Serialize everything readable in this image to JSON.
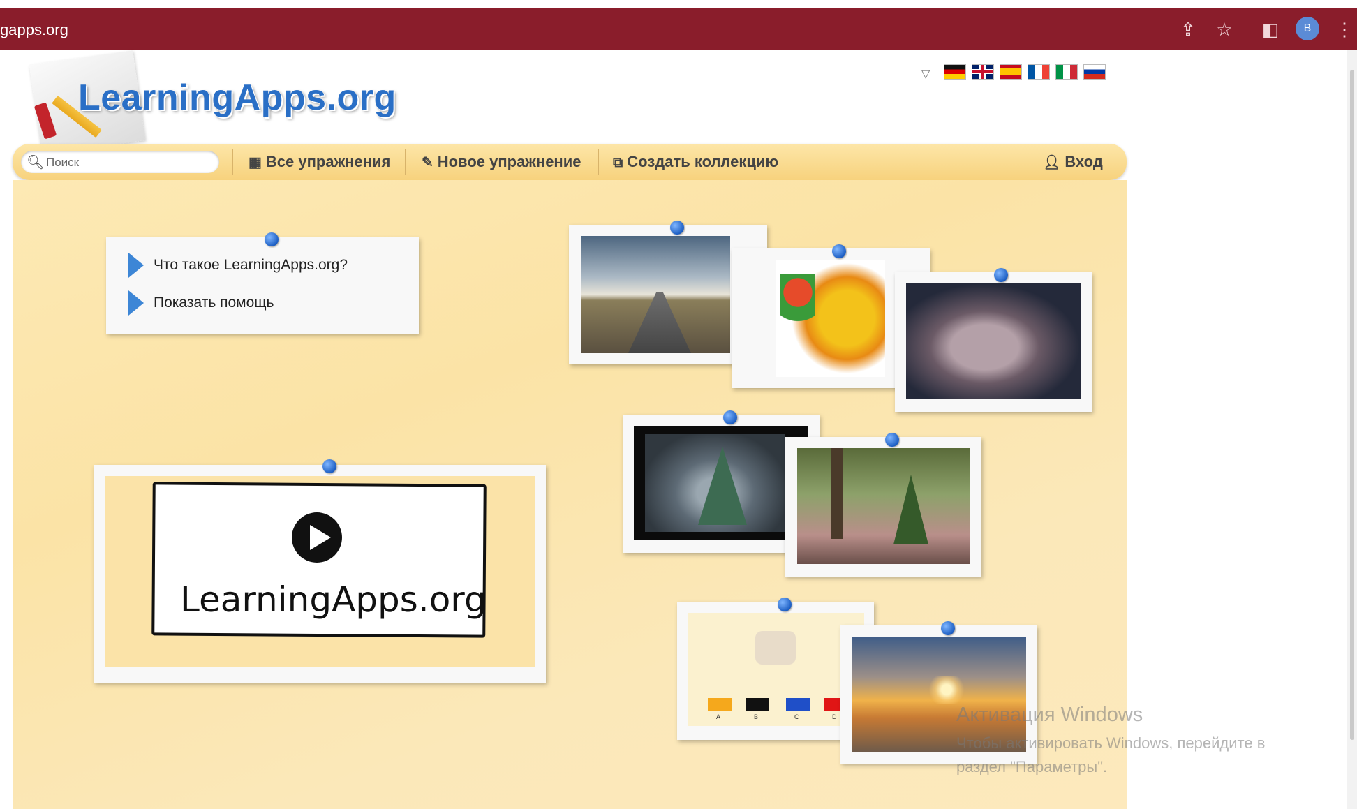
{
  "browser": {
    "url": "gapps.org",
    "avatar_letter": "B",
    "icons": [
      "share-icon",
      "star-icon",
      "sidepanel-icon",
      "menu-icon"
    ]
  },
  "site": {
    "logo_text": "LearningApps.org",
    "languages": [
      "de",
      "en",
      "es",
      "fr",
      "it",
      "ru"
    ]
  },
  "nav": {
    "search_placeholder": "Поиск",
    "all_exercises": "Все упражнения",
    "new_exercise": "Новое упражнение",
    "create_collection": "Создать коллекцию",
    "login": "Вход"
  },
  "help": {
    "what_is": "Что такое LearningApps.org?",
    "show_help": "Показать помощь"
  },
  "video": {
    "caption": "LearningApps.org"
  },
  "colors_card": {
    "labels": [
      "A",
      "B",
      "C",
      "D"
    ]
  },
  "windows": {
    "line1": "Активация Windows",
    "line2": "Чтобы активировать Windows, перейдите в",
    "line3": "раздел \"Параметры\"."
  },
  "colors": {
    "browser_bar": "#8a1d2b",
    "nav_bg": "#f7d27d",
    "logo_blue": "#2a6fc6",
    "pin_blue": "#1d5fc4"
  }
}
